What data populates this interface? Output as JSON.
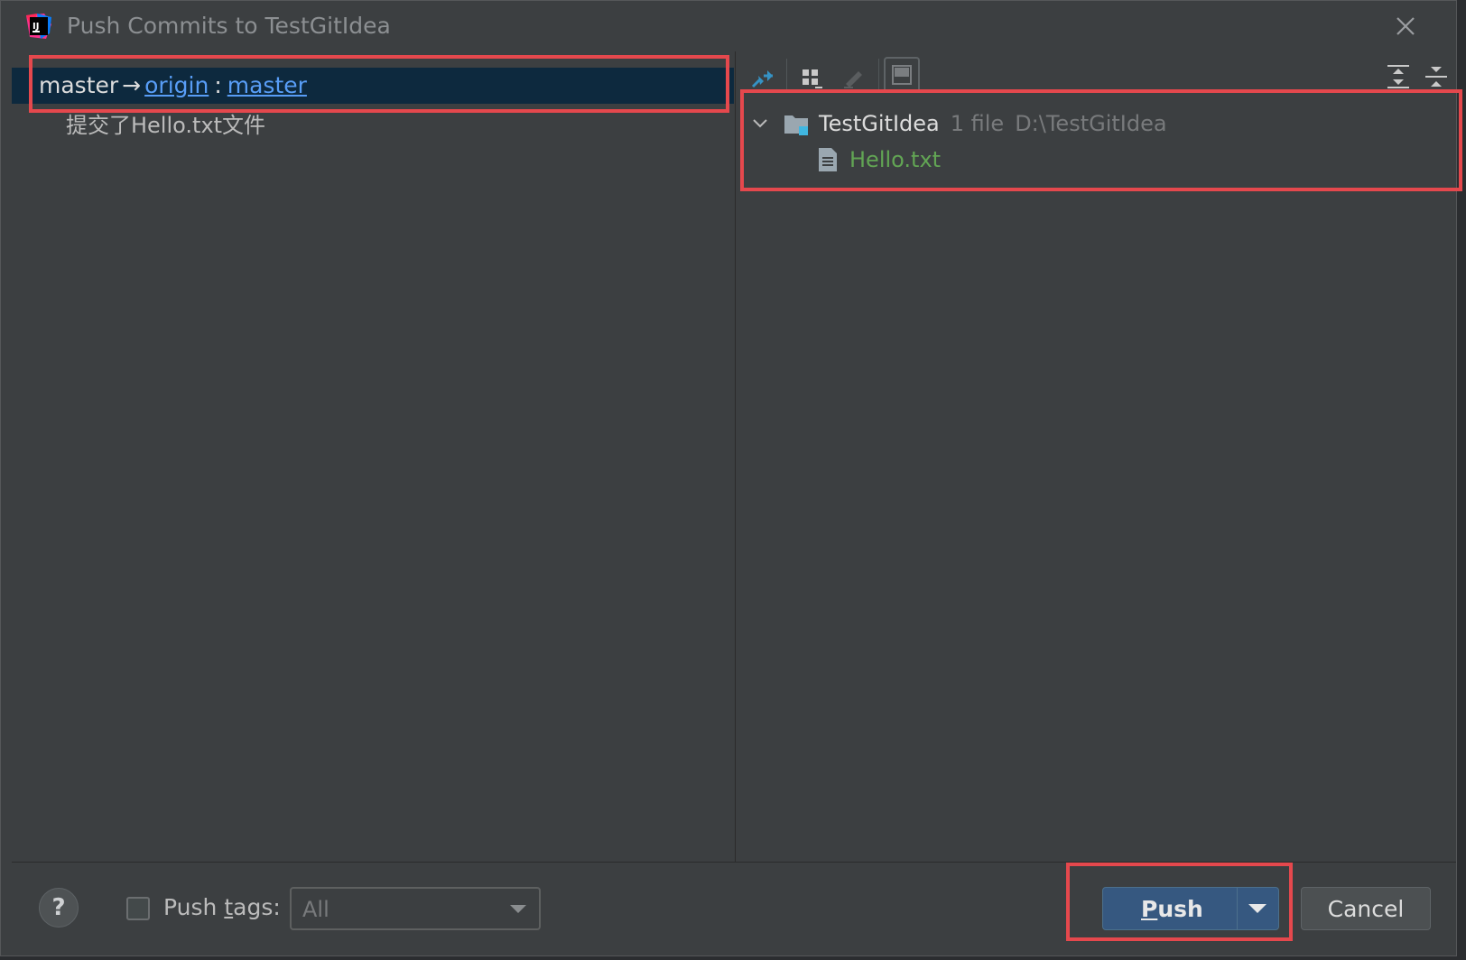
{
  "window": {
    "title": "Push Commits to TestGitIdea",
    "app_icon": "intellij-idea-icon",
    "close_icon": "close-icon"
  },
  "commits_pane": {
    "branch": {
      "local": "master",
      "arrow": "→",
      "remote": "origin",
      "colon": ":",
      "remote_branch": "master"
    },
    "commits": [
      {
        "message": "提交了Hello.txt文件"
      }
    ]
  },
  "toolbar": {
    "icons": [
      "pin-diff-icon",
      "group-by-icon",
      "edit-icon",
      "preview-icon",
      "expand-all-icon",
      "collapse-all-icon"
    ]
  },
  "changes_tree": {
    "repo": {
      "name": "TestGitIdea",
      "count": "1 file",
      "path": "D:\\TestGitIdea"
    },
    "files": [
      {
        "name": "Hello.txt",
        "status_color": "#62a554"
      }
    ]
  },
  "footer": {
    "help_label": "?",
    "push_tags": {
      "label_pre": "Push ",
      "label_mnemonic": "t",
      "label_post": "ags:",
      "checked": false,
      "select_value": "All"
    },
    "push_button": {
      "mnemonic": "P",
      "rest": "ush"
    },
    "cancel_button": "Cancel"
  },
  "colors": {
    "background": "#3c3f41",
    "selection": "#0d293e",
    "link": "#589df6",
    "added_file": "#62a554",
    "primary_button": "#365880",
    "highlight_box": "#e5484d"
  }
}
